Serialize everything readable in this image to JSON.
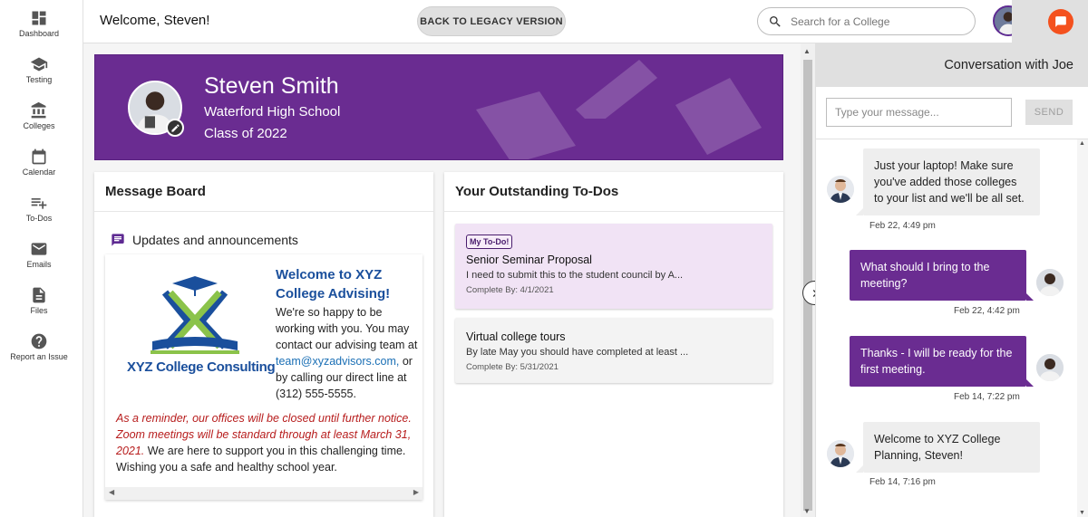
{
  "sidebar": {
    "items": [
      {
        "label": "Dashboard",
        "icon": "dashboard-icon"
      },
      {
        "label": "Testing",
        "icon": "graduation-cap-icon"
      },
      {
        "label": "Colleges",
        "icon": "building-icon"
      },
      {
        "label": "Calendar",
        "icon": "calendar-icon"
      },
      {
        "label": "To-Dos",
        "icon": "playlist-add-icon"
      },
      {
        "label": "Emails",
        "icon": "envelope-icon"
      },
      {
        "label": "Files",
        "icon": "file-icon"
      },
      {
        "label": "Report an Issue",
        "icon": "help-circle-icon"
      }
    ]
  },
  "header": {
    "welcome": "Welcome, Steven!",
    "legacy_button": "BACK TO LEGACY VERSION",
    "search_placeholder": "Search for a College"
  },
  "profile": {
    "name": "Steven Smith",
    "school": "Waterford High School",
    "class_year": "Class of 2022"
  },
  "message_board": {
    "title": "Message Board",
    "section": "Updates and announcements",
    "logo_text": "XYZ College Consulting",
    "heading": "Welcome to XYZ College Advising!",
    "body_before_link": "We're so happy to be working with you. You may contact our advising team at ",
    "link": "team@xyzadvisors.com,",
    "body_after_link": " or by calling our direct line at (312) 555-5555.",
    "notice_italic": "As a reminder, our offices will be closed until further notice. Zoom meetings will be standard through at least March 31, 2021.",
    "notice_rest": " We are here to support you in this challenging time. Wishing you a safe and healthy school year."
  },
  "todos": {
    "title": "Your Outstanding To-Dos",
    "items": [
      {
        "tag": "My To-Do!",
        "title": "Senior Seminar Proposal",
        "desc": "I need to submit this to the student council by A...",
        "due": "Complete By: 4/1/2021"
      },
      {
        "title": "Virtual college tours",
        "desc": "By late May you should have completed at least ...",
        "due": "Complete By: 5/31/2021"
      }
    ]
  },
  "chat": {
    "title": "Conversation with Joe",
    "input_placeholder": "Type your message...",
    "send_label": "SEND",
    "messages": [
      {
        "from": "Joe",
        "text": "Just your laptop! Make sure you've added those colleges to your list and we'll be all set.",
        "time": "Feb 22, 4:49 pm"
      },
      {
        "from": "Steven",
        "text": "What should I bring to the meeting?",
        "time": "Feb 22, 4:42 pm"
      },
      {
        "from": "Steven",
        "text": "Thanks - I will be ready for the first meeting.",
        "time": "Feb 14, 7:22 pm"
      },
      {
        "from": "Joe",
        "text": "Welcome to XYZ College Planning, Steven!",
        "time": "Feb 14, 7:16 pm"
      }
    ]
  },
  "colors": {
    "brand_purple": "#6a2c91",
    "chat_toggle": "#f4511e",
    "logo_blue": "#1a4f9c",
    "notice_red": "#b71c1c"
  }
}
